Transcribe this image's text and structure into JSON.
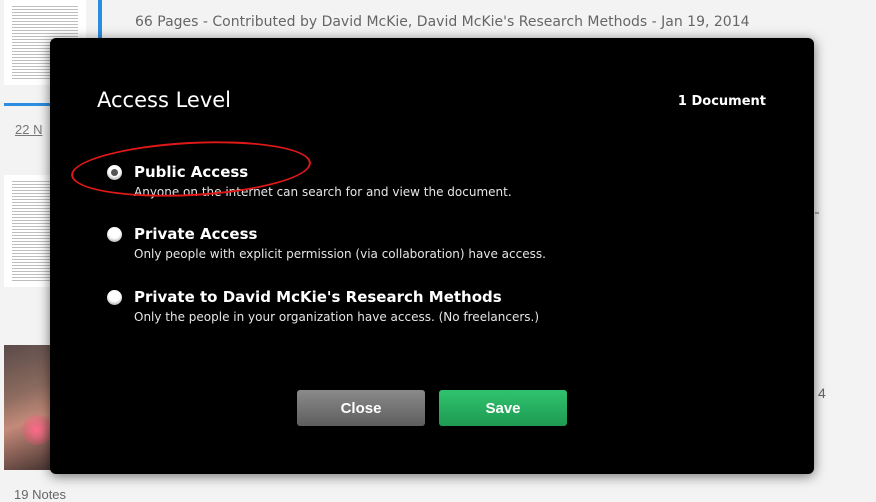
{
  "background": {
    "doc_meta": "66 Pages - Contributed by David McKie, David McKie's Research Methods - Jan 19, 2014",
    "notes_top": "22 N",
    "notes_bottom": "19 Notes",
    "stray_digit": "4"
  },
  "modal": {
    "title": "Access Level",
    "doc_count": "1 Document",
    "options": [
      {
        "label": "Public Access",
        "description": "Anyone on the internet can search for and view the document.",
        "selected": true
      },
      {
        "label": "Private Access",
        "description": "Only people with explicit permission (via collaboration) have access.",
        "selected": false
      },
      {
        "label": "Private to David McKie's Research Methods",
        "description": "Only the people in your organization have access. (No freelancers.)",
        "selected": false
      }
    ],
    "close_label": "Close",
    "save_label": "Save"
  },
  "colors": {
    "modal_bg": "#000000",
    "save_green": "#27ae60",
    "close_gray": "#6e6e6e",
    "highlight_red": "#e01818",
    "link_blue": "#2c8de0"
  }
}
